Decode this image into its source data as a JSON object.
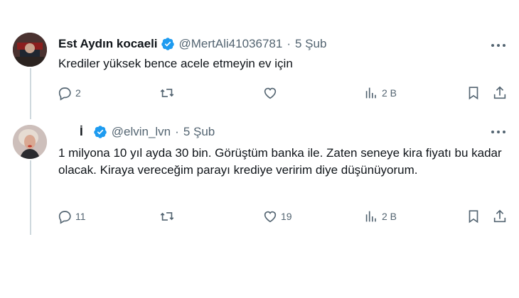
{
  "tweets": [
    {
      "name": "Est Aydın kocaeli",
      "handle": "@MertAli41036781",
      "separator": "·",
      "time": "5 Şub",
      "text": "Krediler yüksek bence acele etmeyin ev için",
      "replies": "2",
      "retweets": "",
      "likes": "",
      "views": "2 B"
    },
    {
      "name": "İ",
      "handle": "@elvin_lvn",
      "separator": "·",
      "time": "5 Şub",
      "text": "1 milyona 10 yıl ayda 30 bin. Görüştüm banka ile. Zaten seneye kira fiyatı bu kadar olacak. Kiraya vereceğim parayı krediye veririm diye düşünüyorum.",
      "replies": "11",
      "retweets": "",
      "likes": "19",
      "views": "2 B"
    }
  ],
  "colors": {
    "verified": "#1d9bf0",
    "muted": "#536471",
    "thread": "#cfd9de"
  }
}
